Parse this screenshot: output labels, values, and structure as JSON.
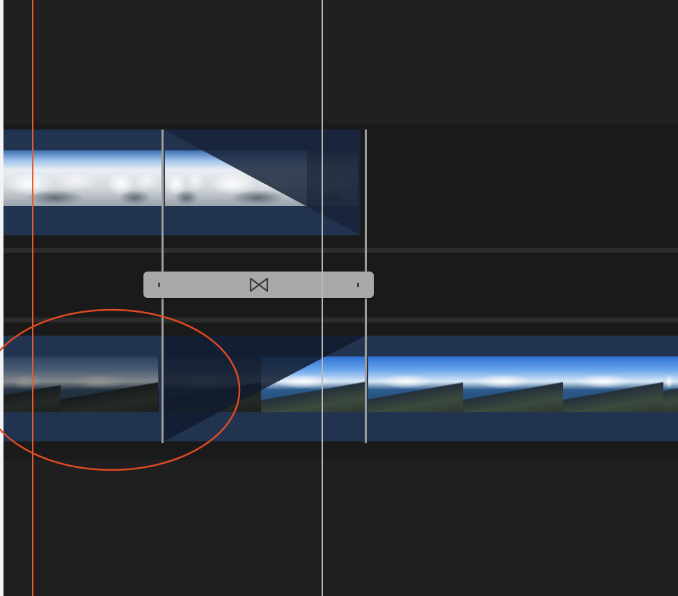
{
  "app": {
    "view": "timeline",
    "colors": {
      "background": "#1f1f1f",
      "clip": "#22334f",
      "playhead": "#e85a2b",
      "skimmer": "#b9b9b9",
      "transition_bar": "#a9a9a9",
      "annotation": "#e04a23"
    }
  },
  "timeline": {
    "upper_clip": {
      "content": "aerial-clouds",
      "frames": 4
    },
    "lower_clip": {
      "content": "aerial-coastline",
      "frames": 7
    },
    "transition": {
      "icon": "bowtie-icon",
      "type": "cross-dissolve"
    }
  },
  "annotation": {
    "shape": "ellipse",
    "color": "#e04a23"
  }
}
